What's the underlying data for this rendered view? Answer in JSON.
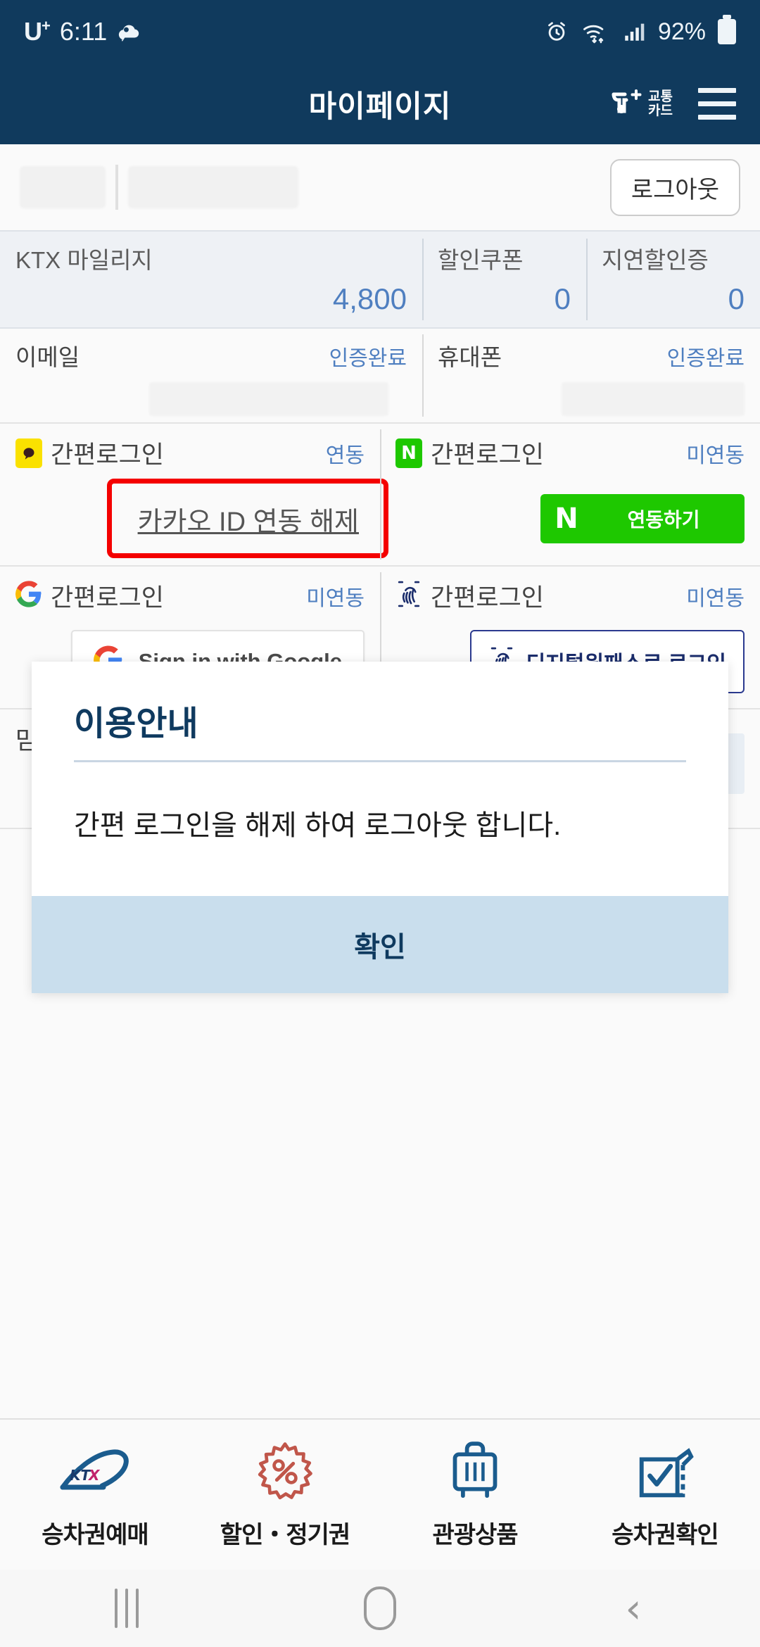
{
  "status_bar": {
    "carrier": "U",
    "carrier_sup": "+",
    "time": "6:11",
    "weather_icon": "weather-cloud-icon",
    "alarm_icon": "alarm-clock-icon",
    "wifi_icon": "wifi-icon",
    "signal_icon": "cellular-signal-icon",
    "battery_percent": "92%"
  },
  "app_bar": {
    "title": "마이페이지",
    "transit_card": {
      "mark": "꺅",
      "line1": "교통",
      "line2": "카드"
    },
    "menu_icon": "hamburger-menu-icon"
  },
  "profile": {
    "name_redacted": "",
    "id_redacted": "",
    "logout_label": "로그아웃"
  },
  "stats": [
    {
      "label": "KTX 마일리지",
      "value": "4,800"
    },
    {
      "label": "할인쿠폰",
      "value": "0"
    },
    {
      "label": "지연할인증",
      "value": "0"
    }
  ],
  "verify": [
    {
      "label": "이메일",
      "status": "인증완료",
      "value_redacted": ""
    },
    {
      "label": "휴대폰",
      "status": "인증완료",
      "value_redacted": ""
    }
  ],
  "sns": {
    "kakao": {
      "icon": "kakao-talk-icon",
      "label": "간편로그인",
      "state": "연동",
      "action_label": "카카오 ID 연동 해제",
      "highlight_color": "#f40000"
    },
    "naver": {
      "icon": "naver-icon",
      "label": "간편로그인",
      "state": "미연동",
      "button_mark": "N",
      "button_label": "연동하기",
      "button_color": "#1ec800"
    },
    "google": {
      "icon": "google-icon",
      "label": "간편로그인",
      "state": "미연동",
      "button_label": "Sign in with Google"
    },
    "onepass": {
      "icon": "fingerprint-icon",
      "label": "간편로그인",
      "state": "미연동",
      "button_label": "디지털원패스로 로그인",
      "button_border_color": "#2b3a8f"
    }
  },
  "obscured_row": {
    "left_label": "맘",
    "right_button": "barcode-button"
  },
  "modal": {
    "title": "이용안내",
    "message": "간편 로그인을 해제 하여 로그아웃 합니다.",
    "confirm_label": "확인",
    "confirm_bg": "#c9deed"
  },
  "tabbar": [
    {
      "icon": "ktx-train-icon",
      "label": "승차권예매"
    },
    {
      "icon": "discount-percent-icon",
      "label": "할인・정기권"
    },
    {
      "icon": "suitcase-icon",
      "label": "관광상품"
    },
    {
      "icon": "ticket-check-icon",
      "label": "승차권확인"
    }
  ],
  "android_nav": {
    "recents": "recents-icon",
    "home": "home-icon",
    "back": "‹"
  },
  "colors": {
    "header_navy": "#103a5d",
    "accent_blue": "#4f7fc0",
    "page_bg": "#fafafa"
  }
}
